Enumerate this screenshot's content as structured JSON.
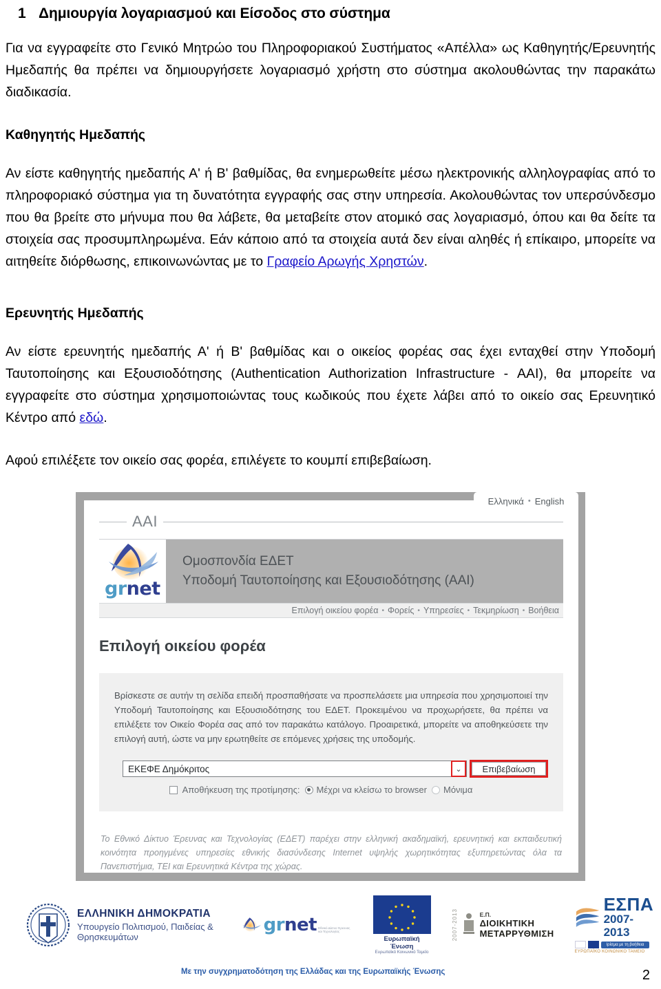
{
  "heading": {
    "number": "1",
    "title": "Δημιουργία λογαριασμού και Είσοδος στο σύστημα"
  },
  "intro_paragraph": "Για να εγγραφείτε στο Γενικό Μητρώο του Πληροφοριακού Συστήματος «Απέλλα» ως Καθηγητής/Ερευνητής Ημεδαπής θα πρέπει να δημιουργήσετε λογαριασμό χρήστη στο σύστημα ακολουθώντας την παρακάτω διαδικασία.",
  "section_professor": {
    "title": "Καθηγητής Ημεδαπής",
    "body_before_link": "Αν είστε καθηγητής ημεδαπής Α' ή Β' βαθμίδας, θα ενημερωθείτε μέσω ηλεκτρονικής αλληλογραφίας από το πληροφοριακό σύστημα για τη δυνατότητα εγγραφής σας στην υπηρεσία. Ακολουθώντας τον υπερσύνδεσμο που θα βρείτε στο μήνυμα που θα λάβετε, θα μεταβείτε στον ατομικό σας λογαριασμό, όπου και θα δείτε τα στοιχεία σας προσυμπληρωμένα. Εάν κάποιο από τα στοιχεία αυτά δεν είναι αληθές ή επίκαιρο, μπορείτε να αιτηθείτε διόρθωσης, επικοινωνώντας με το ",
    "link_text": "Γραφείο Αρωγής Χρηστών",
    "body_after_link": "."
  },
  "section_researcher": {
    "title": "Ερευνητής Ημεδαπής",
    "body_before_link": "Αν είστε ερευνητής ημεδαπής Α' ή Β' βαθμίδας και ο οικείος φορέας σας έχει ενταχθεί στην Υποδομή Ταυτοποίησης και Εξουσιοδότησης (Authentication Authorization Infrastructure - ΑΑΙ), θα μπορείτε να εγγραφείτε στο σύστημα χρησιμοποιώντας τους κωδικούς που έχετε λάβει από το οικείο σας Ερευνητικό Κέντρο από ",
    "link_text": "εδώ",
    "body_after_link": "."
  },
  "closing_paragraph": "Αφού επιλέξετε τον οικείο σας φορέα, επιλέγετε το κουμπί επιβεβαίωση.",
  "aai_screenshot": {
    "lang_greek": "Ελληνικά",
    "lang_separator": "•",
    "lang_english": "English",
    "aai_label": "AAI",
    "logo_word_gr": "gr",
    "logo_word_net": "net",
    "brand_line1": "Ομοσπονδία ΕΔΕΤ",
    "brand_line2": "Υποδομή Ταυτοποίησης και Εξουσιοδότησης (ΑΑΙ)",
    "nav_items": [
      "Επιλογή οικείου φορέα",
      "Φορείς",
      "Υπηρεσίες",
      "Τεκμηρίωση",
      "Βοήθεια"
    ],
    "nav_separator": "•",
    "panel_title": "Επιλογή οικείου φορέα",
    "card_text": "Βρίσκεστε σε αυτήν τη σελίδα επειδή προσπαθήσατε να προσπελάσετε μια υπηρεσία που χρησιμοποιεί την Υποδομή Ταυτοποίησης και Εξουσιοδότησης του ΕΔΕΤ. Προκειμένου να προχωρήσετε, θα πρέπει να επιλέξετε τον Οικείο Φορέα σας από τον παρακάτω κατάλογο. Προαιρετικά, μπορείτε να αποθηκεύσετε την επιλογή αυτή, ώστε να μην ερωτηθείτε σε επόμενες χρήσεις της υποδομής.",
    "select_value": "ΕΚΕΦΕ Δημόκριτος",
    "select_caret": "⌄",
    "confirm_label": "Επιβεβαίωση",
    "pref_checkbox_label": "Αποθήκευση της προτίμησης:",
    "pref_option_session": "Μέχρι να κλείσω το browser",
    "pref_option_permanent": "Μόνιμα",
    "footnote": "Το Εθνικό Δίκτυο Έρευνας και Τεχνολογίας (ΕΔΕΤ) παρέχει στην ελληνική ακαδημαϊκή, ερευνητική και εκπαιδευτική κοινότητα προηγμένες υπηρεσίες εθνικής διασύνδεσης Internet υψηλής χωρητικότητας εξυπηρετώντας όλα τα Πανεπιστήμια, ΤΕΙ και Ερευνητικά Κέντρα της χώρας.",
    "highlight_color": "#e02020",
    "header_band_color": "#b0b0b0",
    "frame_color": "#a3a3a3"
  },
  "footer_logos": {
    "hellenic_republic_line1": "ΕΛΛΗΝΙΚΗ ΔΗΜΟΚΡΑΤΙΑ",
    "hellenic_republic_line2": "Υπουργείο Πολιτισμού, Παιδείας & Θρησκευμάτων",
    "grnet_gr": "gr",
    "grnet_net": "net",
    "grnet_sub": "Εθνικό Δίκτυο Έρευνας και Τεχνολογίας",
    "eu_caption1": "Ευρωπαϊκή Ένωση",
    "eu_caption2": "Ευρωπαϊκό Κοινωνικό Ταμείο",
    "op_small": "Ε.Π.",
    "op_line1": "ΔΙΟΙΚΗΤΙΚΗ",
    "op_line2": "ΜΕΤΑΡΡΥΘΜΙΣΗ",
    "op_years": "2007-2013",
    "espa_title": "ΕΣΠΑ",
    "espa_years": "2007-2013",
    "espa_pill": "Ιρίσμα με τη βοήθεια",
    "espa_foot": "ΕΥΡΩΠΑΪΚΟ ΚΟΙΝΩΝΙΚΟ ΤΑΜΕΙΟ",
    "cofunding": "Με την συγχρηματοδότηση της Ελλάδας και της Ευρωπαϊκής Ένωσης"
  },
  "page_number": "2"
}
